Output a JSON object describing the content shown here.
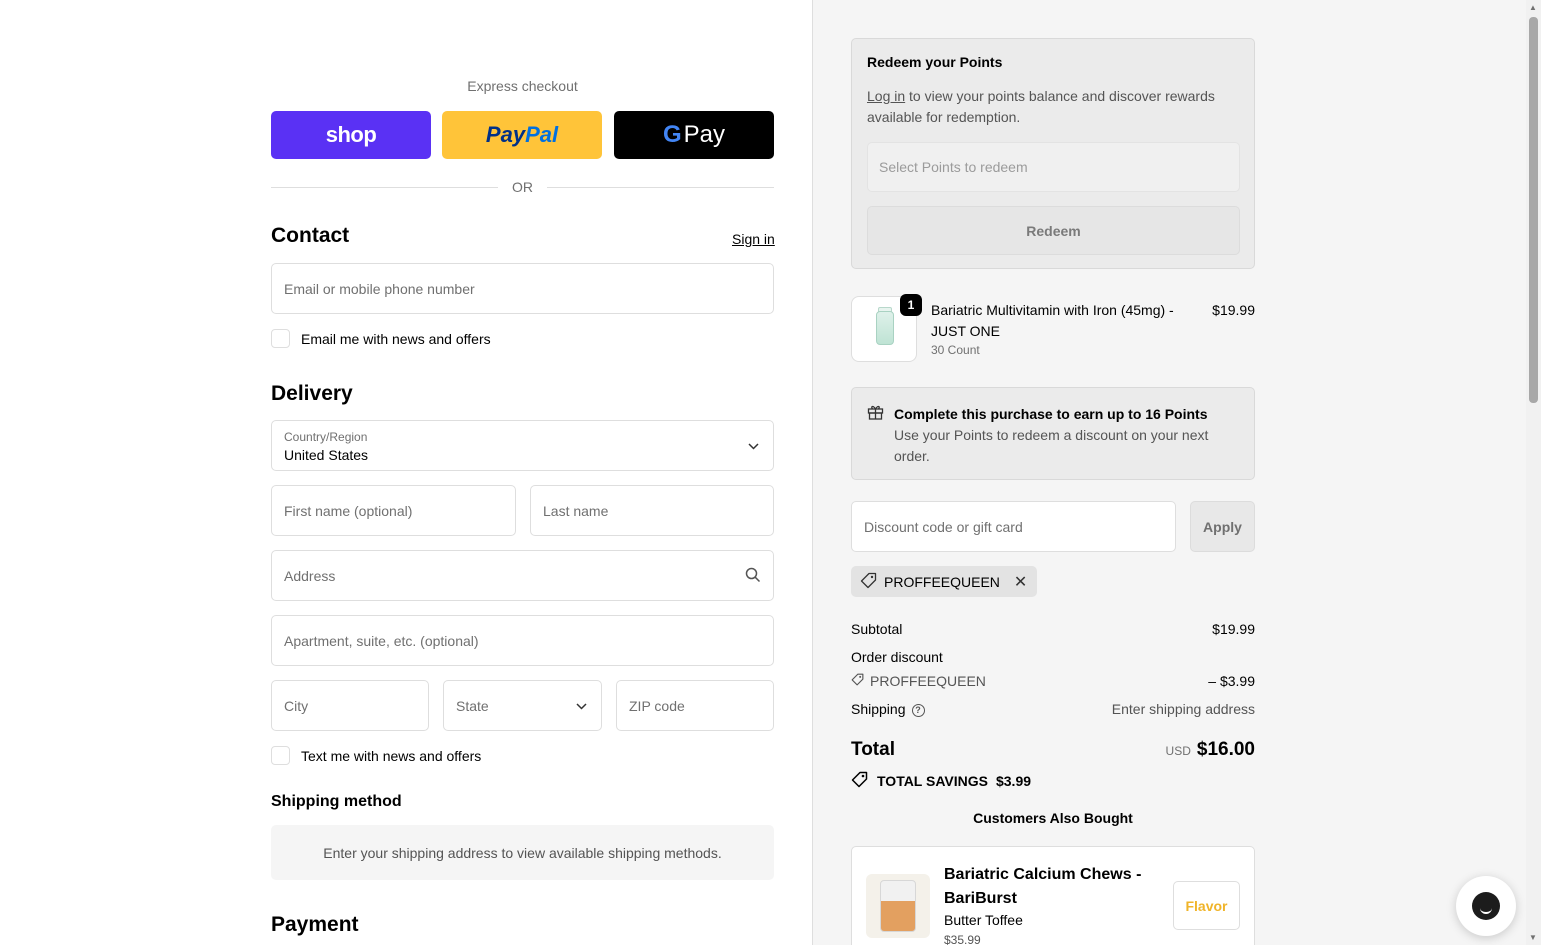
{
  "express": {
    "title": "Express checkout",
    "shop_label": "shop",
    "paypal_pay": "Pay",
    "paypal_pal": "Pal",
    "gpay_g": "G",
    "gpay_label": "Pay",
    "or_label": "OR"
  },
  "contact": {
    "heading": "Contact",
    "sign_in": "Sign in",
    "email_placeholder": "Email or mobile phone number",
    "news_label": "Email me with news and offers"
  },
  "delivery": {
    "heading": "Delivery",
    "country_label": "Country/Region",
    "country_value": "United States",
    "first_name": "First name (optional)",
    "last_name": "Last name",
    "address": "Address",
    "apartment": "Apartment, suite, etc. (optional)",
    "city": "City",
    "state": "State",
    "zip": "ZIP code",
    "text_label": "Text me with news and offers"
  },
  "shipping_method": {
    "heading": "Shipping method",
    "message": "Enter your shipping address to view available shipping methods."
  },
  "payment": {
    "heading": "Payment"
  },
  "redeem": {
    "title": "Redeem your Points",
    "login_link": "Log in",
    "text": " to view your points balance and discover rewards available for redemption.",
    "select_placeholder": "Select Points to redeem",
    "button": "Redeem"
  },
  "product": {
    "quantity": "1",
    "name": "Bariatric Multivitamin with Iron (45mg) - JUST ONE",
    "variant": "30 Count",
    "price": "$19.99"
  },
  "earn": {
    "title": "Complete this purchase to earn up to 16 Points",
    "text": "Use your Points to redeem a discount on your next order."
  },
  "discount": {
    "placeholder": "Discount code or gift card",
    "apply": "Apply",
    "applied_code": "PROFFEEQUEEN"
  },
  "summary": {
    "subtotal_label": "Subtotal",
    "subtotal_value": "$19.99",
    "order_discount_label": "Order discount",
    "discount_code": "PROFFEEQUEEN",
    "discount_value": "– $3.99",
    "shipping_label": "Shipping",
    "shipping_value": "Enter shipping address",
    "total_label": "Total",
    "currency": "USD",
    "total_value": "$16.00",
    "savings_label": "TOTAL SAVINGS",
    "savings_value": "$3.99"
  },
  "also_bought": {
    "title": "Customers Also Bought",
    "name": "Bariatric Calcium Chews - BariBurst",
    "variant": "Butter Toffee",
    "price": "$35.99",
    "button": "Flavor"
  },
  "colors": {
    "shop": "#5a31f4",
    "paypal": "#ffc439",
    "gpay": "#000000",
    "right_bg": "#f5f5f5",
    "flavor_accent": "#f0b429"
  }
}
